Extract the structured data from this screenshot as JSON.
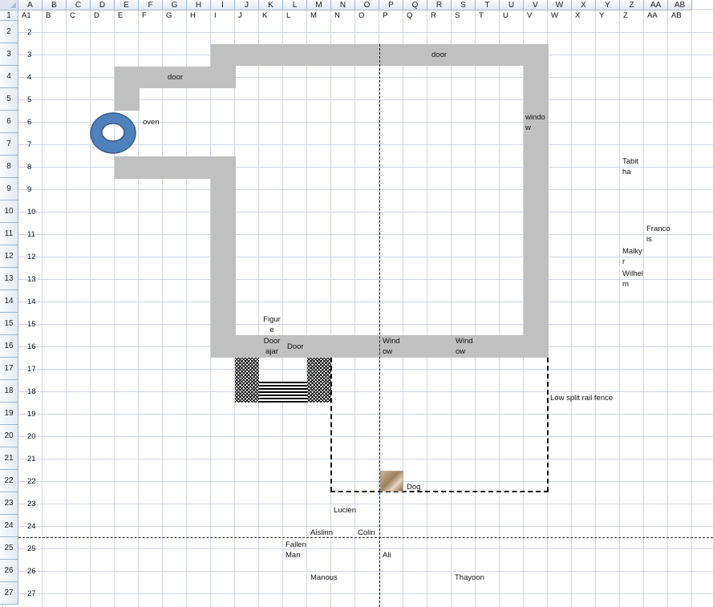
{
  "sheet": {
    "columns": [
      "A",
      "B",
      "C",
      "D",
      "E",
      "F",
      "G",
      "H",
      "I",
      "J",
      "K",
      "L",
      "M",
      "N",
      "O",
      "P",
      "Q",
      "R",
      "S",
      "T",
      "U",
      "V",
      "W",
      "X",
      "Y",
      "Z",
      "AA",
      "AB"
    ],
    "rows": [
      "1",
      "2",
      "3",
      "4",
      "5",
      "6",
      "7",
      "8",
      "9",
      "10",
      "11",
      "12",
      "13",
      "14",
      "15",
      "16",
      "17",
      "18",
      "19",
      "20",
      "21",
      "22",
      "23",
      "24",
      "25",
      "26",
      "27"
    ],
    "a1_value": "A1",
    "column_letters_row": [
      "B",
      "C",
      "D",
      "E",
      "F",
      "G",
      "H",
      "I",
      "J",
      "K",
      "L",
      "M",
      "N",
      "O",
      "P",
      "Q",
      "R",
      "S",
      "T",
      "U",
      "V",
      "W",
      "X",
      "Y",
      "Z",
      "AA",
      "AB"
    ],
    "row_numbers_col": [
      "2",
      "3",
      "4",
      "5",
      "6",
      "7",
      "8",
      "9",
      "10",
      "11",
      "12",
      "13",
      "14",
      "15",
      "16",
      "17",
      "18",
      "19",
      "20",
      "21",
      "22",
      "23",
      "24",
      "25",
      "26",
      "27"
    ]
  },
  "labels": {
    "door_top": "door",
    "door_left": "door",
    "oven": "oven",
    "window_right": "windo w",
    "figure": "Figur e",
    "door_ajar": "Door ajar",
    "door_bottom": "Door",
    "window_bottom_1": "Wind ow",
    "window_bottom_2": "Wind ow",
    "fence": "Low split rail fence",
    "dog": "Dog"
  },
  "people": {
    "tabitha": "Tabit ha",
    "francois": "Franco is",
    "malkyr": "Malky r",
    "wilhelm": "Wilhel m",
    "lucien": "Lucien",
    "aislinn": "Aislinn",
    "colin": "Colin",
    "fallen_man": "Fallen Man",
    "ali": "Ali",
    "manous": "Manous",
    "thayoon": "Thayoon"
  },
  "colors": {
    "wall": "#c0c0c0",
    "oven_fill": "#4f81bd",
    "oven_stroke": "#385d8a",
    "grid": "#d0d7e5",
    "header": "#e4eaf3"
  },
  "icons": {
    "oven": "donut-shape",
    "dog": "dog-photo"
  }
}
